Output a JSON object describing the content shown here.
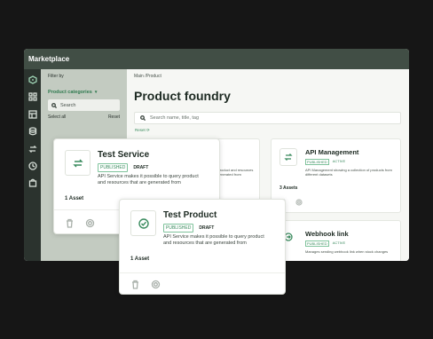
{
  "window": {
    "title": "Marketplace"
  },
  "filter": {
    "title": "Filter by",
    "category_label": "Product categories",
    "search_placeholder": "Search",
    "select_all": "Select all",
    "reset": "Reset"
  },
  "main": {
    "breadcrumb": "Main /Product",
    "title": "Product foundry",
    "search_placeholder": "Search name, title, tag",
    "reset_label": "Reset"
  },
  "background_cards": [
    {
      "title": "API Management",
      "badge_status": "PUBLISHED",
      "badge_state": "ACTIVE",
      "description": "API Management showing a collection of products from different datasets",
      "assets": "3 Assets"
    },
    {
      "title": "Webhook link",
      "badge_status": "PUBLISHED",
      "badge_state": "ACTIVE",
      "description": "Manages sending webhook link when stock changes"
    }
  ],
  "partial_card": {
    "description": "to query product and resources that are generated from"
  },
  "cards": [
    {
      "title": "Test Service",
      "badge_status": "PUBLISHED",
      "badge_state": "DRAFT",
      "description": "API Service makes it possible to query product and resources that are generated from",
      "assets": "1 Asset"
    },
    {
      "title": "Test Product",
      "badge_status": "PUBLISHED",
      "badge_state": "DRAFT",
      "description": "API Service makes it possible to query product and resources that are generated from",
      "assets": "1 Asset"
    }
  ],
  "colors": {
    "accent": "#3a8b5e",
    "titlebar": "#414e45",
    "rail": "#2b332e",
    "filter_panel": "#c3cbc1"
  }
}
